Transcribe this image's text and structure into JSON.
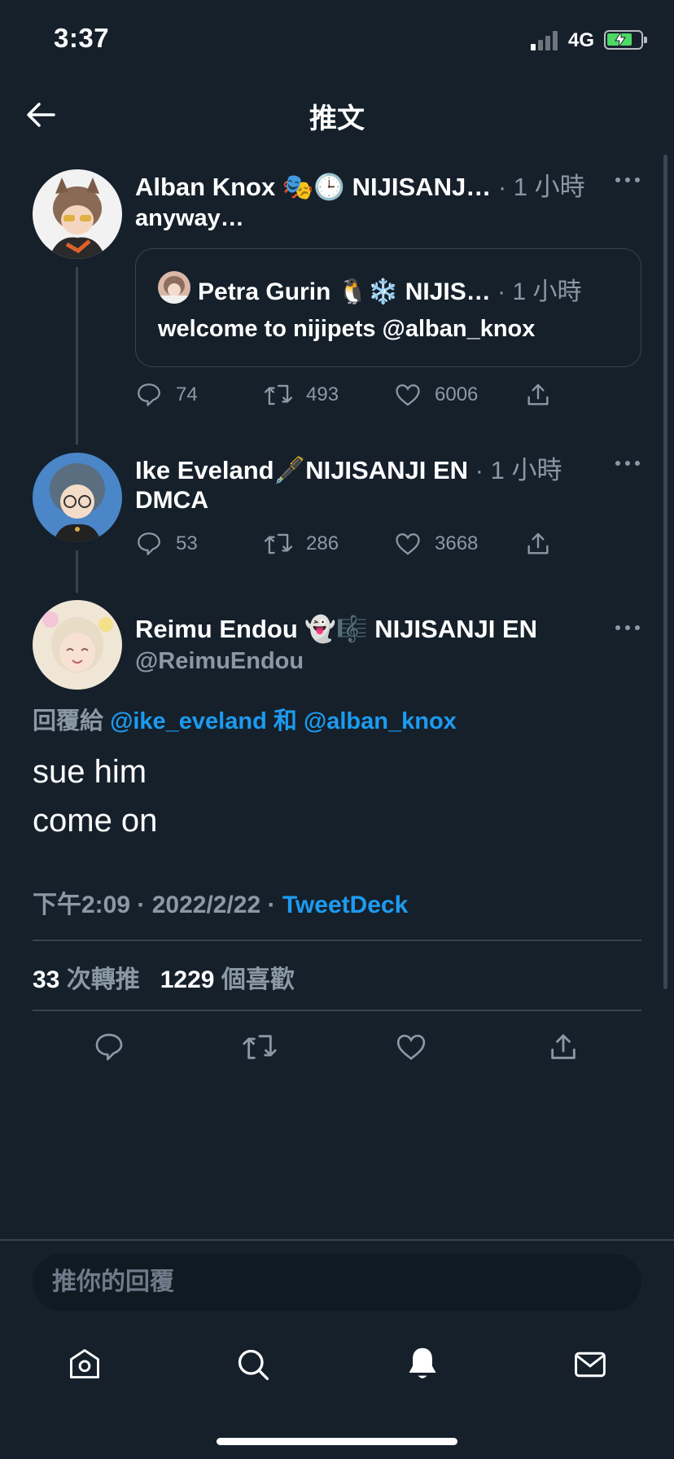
{
  "status_bar": {
    "time": "3:37",
    "network": "4G",
    "signal_bars_active": 1,
    "battery_charging": true
  },
  "header": {
    "title": "推文"
  },
  "thread": [
    {
      "name": "Alban Knox 🎭🕒 NIJISANJ…",
      "time": "· 1 小時",
      "text": "anyway…",
      "quote": {
        "name": "Petra Gurin 🐧❄️ NIJIS…",
        "time": "· 1 小時",
        "text": "welcome to nijipets @alban_knox"
      },
      "replies": "74",
      "retweets": "493",
      "likes": "6006"
    },
    {
      "name": "Ike Eveland🖋️NIJISANJI EN",
      "time": "· 1 小時",
      "text": "DMCA",
      "replies": "53",
      "retweets": "286",
      "likes": "3668"
    }
  ],
  "main_tweet": {
    "name": "Reimu Endou 👻🎼 NIJISANJI EN",
    "handle": "@ReimuEndou",
    "reply_prefix": "回覆給",
    "reply_user1": "@ike_eveland",
    "reply_and": "和",
    "reply_user2": "@alban_knox",
    "text_line1": "sue him",
    "text_line2": "come on",
    "timestamp": "下午2:09 · 2022/2/22 · ",
    "source": "TweetDeck",
    "retweet_count": "33",
    "retweet_label": "次轉推",
    "like_count": "1229",
    "like_label": "個喜歡"
  },
  "composer": {
    "placeholder": "推你的回覆"
  },
  "colors": {
    "background": "#15202b",
    "accent": "#1d9bf0",
    "muted": "#8b98a5",
    "border": "#38444d"
  },
  "bottom_nav": [
    "home-icon",
    "search-icon",
    "notifications-icon",
    "messages-icon"
  ]
}
